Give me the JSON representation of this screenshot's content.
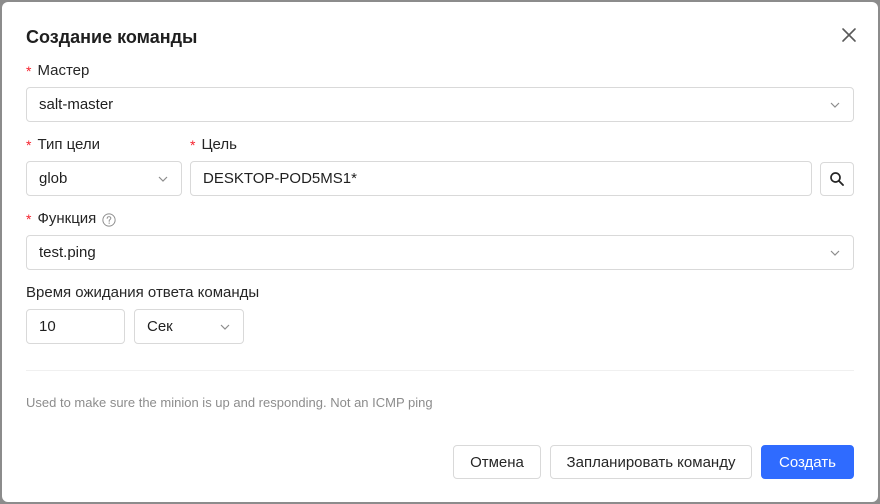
{
  "dialog": {
    "title": "Создание команды"
  },
  "form": {
    "master": {
      "label": "Мастер",
      "value": "salt-master"
    },
    "target_type": {
      "label": "Тип цели",
      "value": "glob"
    },
    "target": {
      "label": "Цель",
      "value": "DESKTOP-POD5MS1*"
    },
    "function": {
      "label": "Функция",
      "value": "test.ping"
    },
    "timeout": {
      "label": "Время ожидания ответа команды",
      "value": "10",
      "unit": "Сек"
    },
    "required_mark": "*"
  },
  "description": "Used to make sure the minion is up and responding. Not an ICMP ping",
  "footer": {
    "cancel_label": "Отмена",
    "schedule_label": "Запланировать команду",
    "create_label": "Создать"
  },
  "icons": {
    "close": "close-icon",
    "chevron": "chevron-down-icon",
    "search": "search-icon",
    "help": "question-circle-icon"
  },
  "colors": {
    "primary": "#2f6bff",
    "required": "#f5222d"
  }
}
